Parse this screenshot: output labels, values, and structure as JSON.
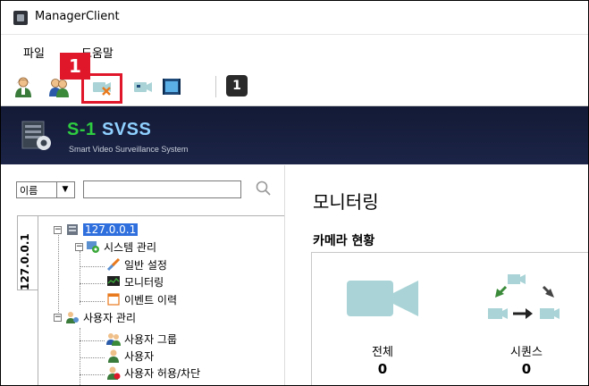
{
  "window": {
    "title": "ManagerClient"
  },
  "menu": {
    "file": "파일",
    "help": "도움말"
  },
  "toolbar": {
    "number_button": "1"
  },
  "callout": {
    "number": "1"
  },
  "banner": {
    "brand_s1": "S-1",
    "brand_svss": "SVSS",
    "subtitle": "Smart Video Surveillance System"
  },
  "search": {
    "field_option": "이름",
    "value": ""
  },
  "side_tab": {
    "label": "127.0.0.1"
  },
  "tree": {
    "root": "127.0.0.1",
    "system": "시스템 관리",
    "general_settings": "일반 설정",
    "monitoring": "모니터링",
    "event_history": "이벤트 이력",
    "user_management": "사용자 관리",
    "user_group": "사용자 그룹",
    "user": "사용자",
    "user_allow_block": "사용자 허용/차단"
  },
  "main": {
    "title": "모니터링",
    "section": "카메라 현황",
    "stats": [
      {
        "label": "전체",
        "value": "0"
      },
      {
        "label": "시퀀스",
        "value": "0"
      }
    ]
  },
  "colors": {
    "highlight": "#e0162b",
    "banner": "#131a36",
    "selection": "#2f6fdd",
    "brand_green": "#2ecc40",
    "camera_icon": "#a9d3d6"
  }
}
